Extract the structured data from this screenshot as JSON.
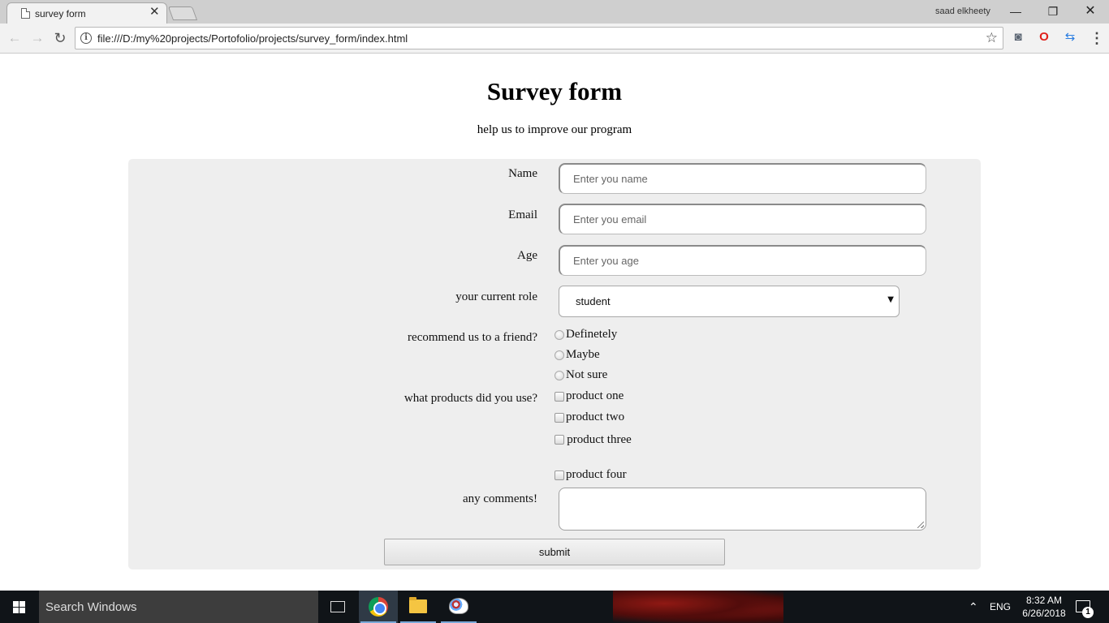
{
  "browser": {
    "tab_title": "survey form",
    "tab_close": "✕",
    "user_name": "saad elkheety",
    "minimize": "—",
    "restore": "❐",
    "close": "✕",
    "url": "file:///D:/my%20projects/Portofolio/projects/survey_form/index.html",
    "back_glyph": "←",
    "forward_glyph": "→",
    "reload_glyph": "↻",
    "info_glyph": "i",
    "bookmark_glyph": "☆",
    "extensions": [
      {
        "name": "speech-bubble-icon",
        "glyph": "◙",
        "color": "#5a6472"
      },
      {
        "name": "opera-icon",
        "glyph": "O",
        "color": "#e0201b"
      },
      {
        "name": "sync-arrows-icon",
        "glyph": "⇆",
        "color": "#2a7de1"
      }
    ],
    "menu_glyph": "⋮"
  },
  "page": {
    "title": "Survey form",
    "subtitle": "help us to improve our program"
  },
  "form": {
    "name": {
      "label": "Name",
      "placeholder": "Enter you name"
    },
    "email": {
      "label": "Email",
      "placeholder": "Enter you email"
    },
    "age": {
      "label": "Age",
      "placeholder": "Enter you age"
    },
    "role": {
      "label": "your current role",
      "selected": "student",
      "arrow": "▼"
    },
    "recommend": {
      "label": "recommend us to a friend?",
      "options": [
        "Definetely",
        "Maybe",
        "Not sure"
      ]
    },
    "products": {
      "label": "what products did you use?",
      "options": [
        "product one",
        "product two",
        "product three",
        "product four"
      ]
    },
    "comments": {
      "label": "any comments!"
    },
    "submit_label": "submit"
  },
  "taskbar": {
    "search_placeholder": "Search Windows",
    "apps": [
      "task-view",
      "google-chrome",
      "file-explorer",
      "paint"
    ],
    "tray_chevron": "⌃",
    "language": "ENG",
    "time": "8:32 AM",
    "date": "6/26/2018",
    "notification_count": "1"
  }
}
